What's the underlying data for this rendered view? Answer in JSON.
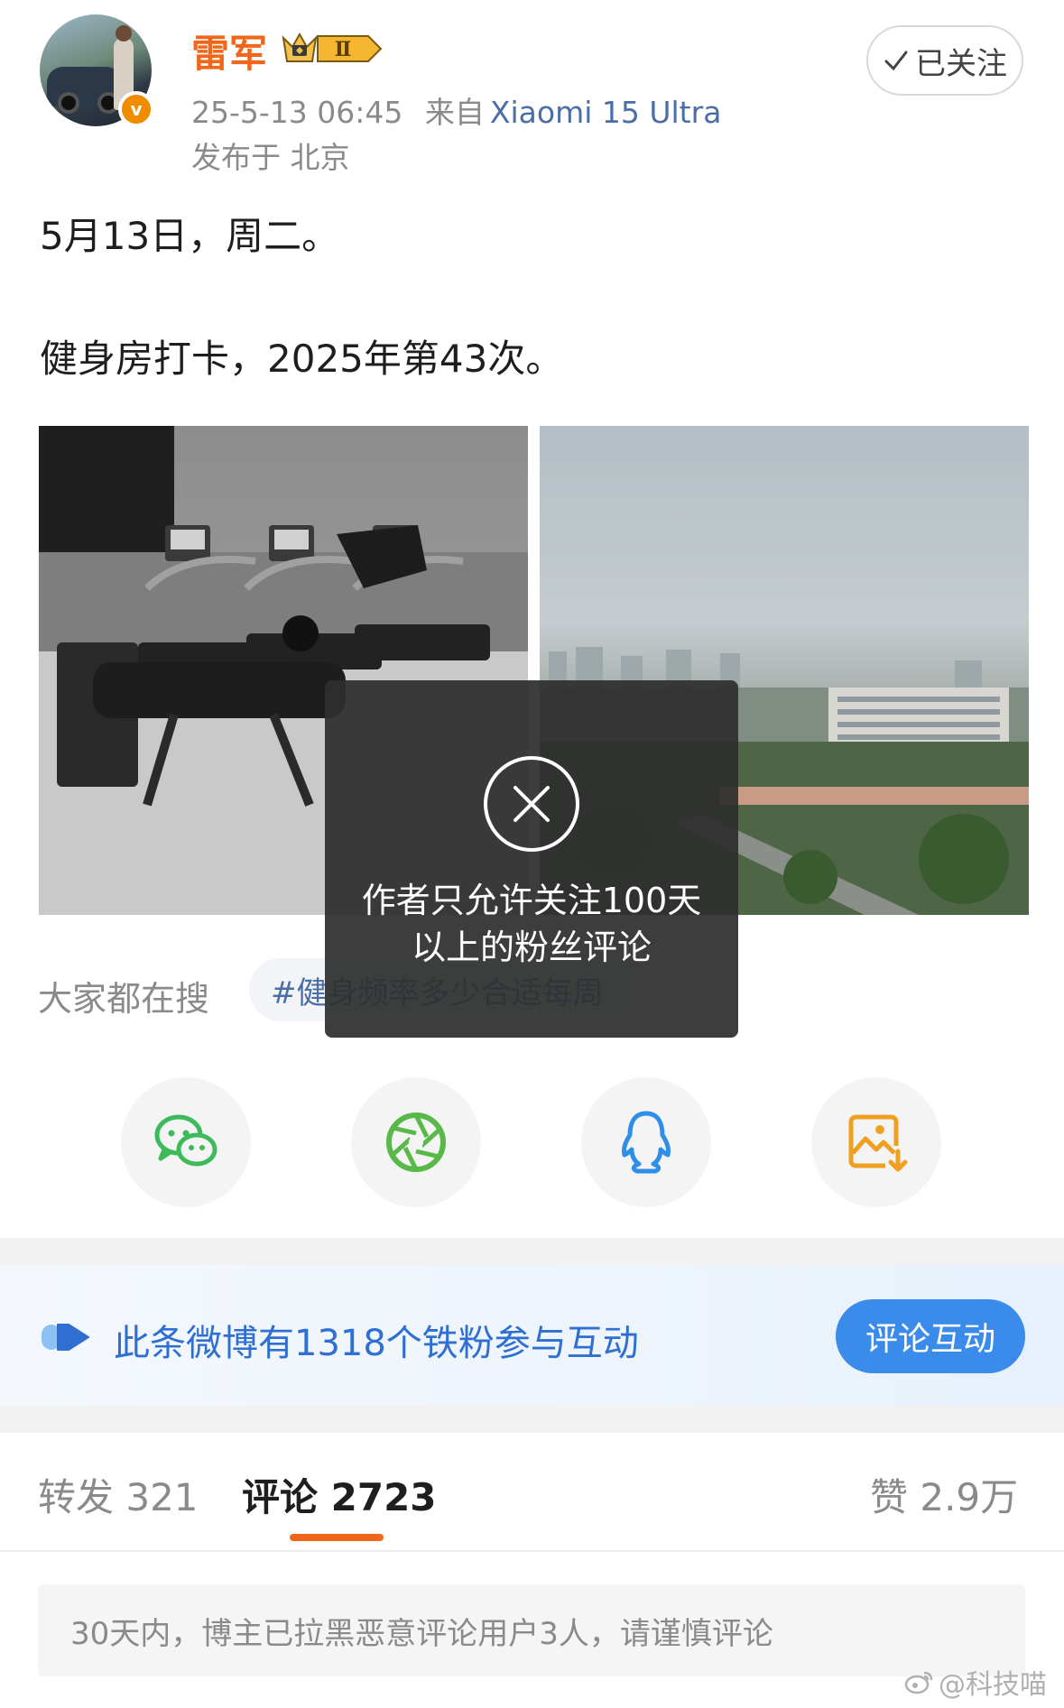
{
  "header": {
    "username": "雷军",
    "vip_level": "Ⅱ",
    "verified_mark": "v",
    "timestamp": "25-5-13 06:45",
    "source_prefix": "来自",
    "device": "Xiaomi 15 Ultra",
    "location": "发布于 北京",
    "follow_label": "已关注",
    "follow_icon": "check-icon"
  },
  "post": {
    "line1": "5月13日，周二。",
    "line2": "健身房打卡，2025年第43次。"
  },
  "images": [
    {
      "name": "gym-photo",
      "alt": "gym treadmills"
    },
    {
      "name": "city-photo",
      "alt": "city view"
    }
  ],
  "search": {
    "label": "大家都在搜",
    "tag": "#健身频率多少合适每周"
  },
  "toast": {
    "icon": "close-circle-icon",
    "message": "作者只允许关注100天以上的粉丝评论"
  },
  "share": [
    {
      "name": "wechat-share-button",
      "icon": "wechat-icon",
      "color": "#3dbb5b"
    },
    {
      "name": "moments-share-button",
      "icon": "aperture-icon",
      "color": "#58b948"
    },
    {
      "name": "qq-share-button",
      "icon": "qq-penguin-icon",
      "color": "#2e8ee8"
    },
    {
      "name": "save-image-button",
      "icon": "image-download-icon",
      "color": "#f0a020"
    }
  ],
  "fans_banner": {
    "text": "此条微博有1318个铁粉参与互动",
    "button": "评论互动"
  },
  "tabs": {
    "repost": "转发 321",
    "comments": "评论 2723",
    "likes": "赞 2.9万"
  },
  "notice": "30天内，博主已拉黑恶意评论用户3人，请谨慎评论",
  "watermark": "@科技喵",
  "colors": {
    "accent_orange": "#f0661a",
    "link_blue": "#4a6ea8",
    "banner_blue": "#2e6fd1",
    "button_blue": "#3b8bea"
  }
}
